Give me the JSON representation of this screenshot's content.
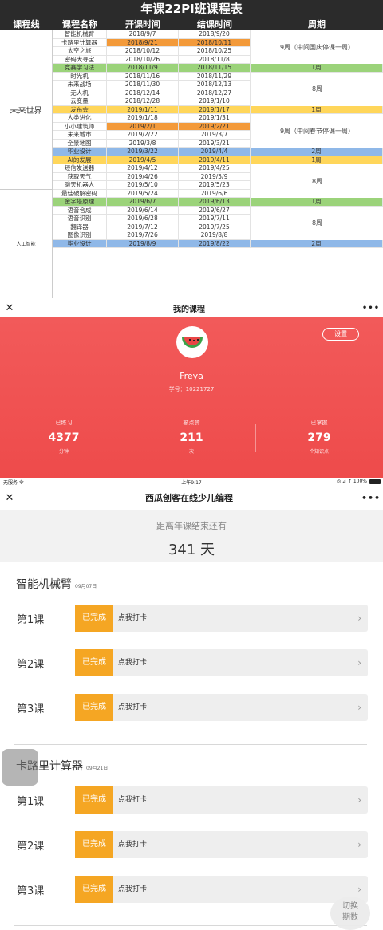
{
  "schedule": {
    "title": "年课22PI班课程表",
    "headers": {
      "line": "课程线",
      "name": "课程名称",
      "start": "开课时间",
      "end": "结课时间",
      "week": "周期"
    },
    "groups": [
      {
        "name": "未来世界"
      },
      {
        "name": "人工智能"
      }
    ],
    "week_groups": [
      {
        "text": "9周（中间国庆停课一周）"
      },
      {
        "text": "8周"
      },
      {
        "text": "9周（中间春节停课一周）"
      },
      {
        "text": "8周"
      },
      {
        "text": "8周"
      }
    ],
    "rows": [
      {
        "name": "智能机械臂",
        "start": "2018/9/7",
        "end": "2018/9/20",
        "week": "",
        "type": ""
      },
      {
        "name": "卡路里计算器",
        "start": "2018/9/21",
        "end": "2018/10/11",
        "week": "",
        "type": "orange"
      },
      {
        "name": "太空之旅",
        "start": "2018/10/12",
        "end": "2018/10/25",
        "week": "",
        "type": ""
      },
      {
        "name": "密码大寻宝",
        "start": "2018/10/26",
        "end": "2018/11/8",
        "week": "",
        "type": ""
      },
      {
        "name": "竞赛学习法",
        "start": "2018/11/9",
        "end": "2018/11/15",
        "week": "1周",
        "type": "green"
      },
      {
        "name": "时光机",
        "start": "2018/11/16",
        "end": "2018/11/29",
        "week": "",
        "type": ""
      },
      {
        "name": "未来战场",
        "start": "2018/11/30",
        "end": "2018/12/13",
        "week": "",
        "type": ""
      },
      {
        "name": "无人机",
        "start": "2018/12/14",
        "end": "2018/12/27",
        "week": "",
        "type": ""
      },
      {
        "name": "云变量",
        "start": "2018/12/28",
        "end": "2019/1/10",
        "week": "",
        "type": ""
      },
      {
        "name": "发布会",
        "start": "2019/1/11",
        "end": "2019/1/17",
        "week": "1周",
        "type": "yellow"
      },
      {
        "name": "人类进化",
        "start": "2019/1/18",
        "end": "2019/1/31",
        "week": "",
        "type": ""
      },
      {
        "name": "小小建筑师",
        "start": "2019/2/1",
        "end": "2019/2/21",
        "week": "",
        "type": "orange"
      },
      {
        "name": "未来城市",
        "start": "2019/2/22",
        "end": "2019/3/7",
        "week": "",
        "type": ""
      },
      {
        "name": "全景地图",
        "start": "2019/3/8",
        "end": "2019/3/21",
        "week": "",
        "type": ""
      },
      {
        "name": "毕业设计",
        "start": "2019/3/22",
        "end": "2019/4/4",
        "week": "2周",
        "type": "blue"
      },
      {
        "name": "AI的发展",
        "start": "2019/4/5",
        "end": "2019/4/11",
        "week": "1周",
        "type": "yellow"
      },
      {
        "name": "短信发送器",
        "start": "2019/4/12",
        "end": "2019/4/25",
        "week": "",
        "type": ""
      },
      {
        "name": "获取天气",
        "start": "2019/4/26",
        "end": "2019/5/9",
        "week": "",
        "type": ""
      },
      {
        "name": "聊天机器人",
        "start": "2019/5/10",
        "end": "2019/5/23",
        "week": "",
        "type": ""
      },
      {
        "name": "最佳破解密码",
        "start": "2019/5/24",
        "end": "2019/6/6",
        "week": "",
        "type": ""
      },
      {
        "name": "金字塔原理",
        "start": "2019/6/7",
        "end": "2019/6/13",
        "week": "1周",
        "type": "green"
      },
      {
        "name": "语音合成",
        "start": "2019/6/14",
        "end": "2019/6/27",
        "week": "",
        "type": ""
      },
      {
        "name": "语音识别",
        "start": "2019/6/28",
        "end": "2019/7/11",
        "week": "",
        "type": ""
      },
      {
        "name": "翻译器",
        "start": "2019/7/12",
        "end": "2019/7/25",
        "week": "",
        "type": ""
      },
      {
        "name": "图像识别",
        "start": "2019/7/26",
        "end": "2019/8/8",
        "week": "",
        "type": ""
      },
      {
        "name": "毕业设计",
        "start": "2019/8/9",
        "end": "2019/8/22",
        "week": "2周",
        "type": "blue"
      }
    ]
  },
  "my_course": {
    "title": "我的课程",
    "settings_label": "设置",
    "user_name": "Freya",
    "user_id": "学号：10221727",
    "stats": [
      {
        "label": "已练习",
        "value": "4377",
        "unit": "分钟"
      },
      {
        "label": "被点赞",
        "value": "211",
        "unit": "次"
      },
      {
        "label": "已掌握",
        "value": "279",
        "unit": "个知识点"
      }
    ]
  },
  "course_detail": {
    "status_left": "无服务 令",
    "status_time": "上午9:17",
    "status_right": "◎ ⊿ ↑ 100%",
    "title": "西瓜创客在线少儿编程",
    "countdown_label": "距离年课结束还有",
    "countdown_value": "341 天",
    "sections": [
      {
        "title": "智能机械臂",
        "date": "09月07日",
        "lessons": [
          {
            "label": "第1课",
            "status": "已完成",
            "action": "点我打卡"
          },
          {
            "label": "第2课",
            "status": "已完成",
            "action": "点我打卡"
          },
          {
            "label": "第3课",
            "status": "已完成",
            "action": "点我打卡"
          }
        ]
      },
      {
        "title": "卡路里计算器",
        "date": "09月21日",
        "lessons": [
          {
            "label": "第1课",
            "status": "已完成",
            "action": "点我打卡"
          },
          {
            "label": "第2课",
            "status": "已完成",
            "action": "点我打卡"
          },
          {
            "label": "第3课",
            "status": "已完成",
            "action": "点我打卡"
          }
        ]
      }
    ],
    "switch_label": "切换\n期数"
  }
}
